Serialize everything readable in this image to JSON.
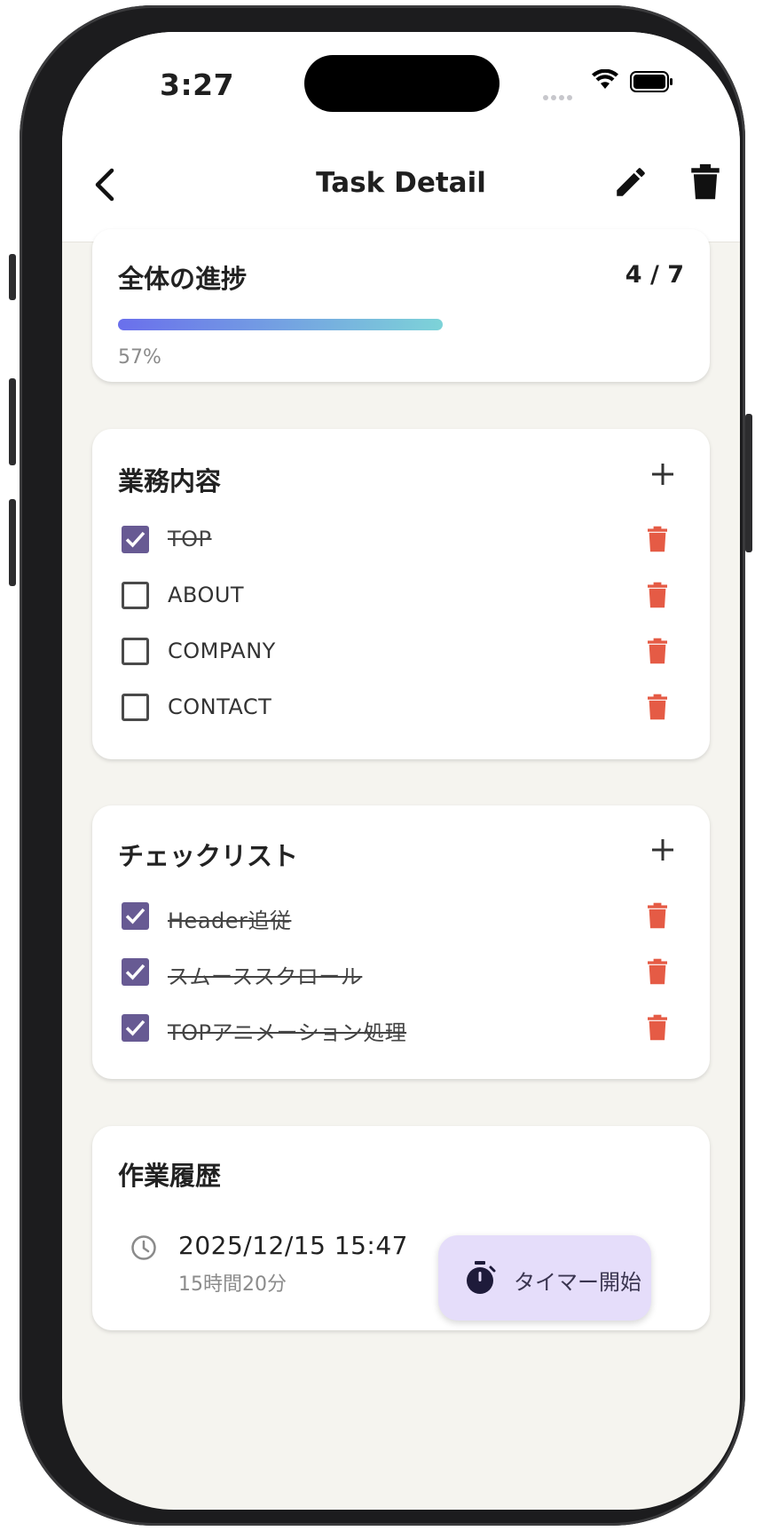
{
  "status_bar": {
    "time": "3:27"
  },
  "app_bar": {
    "title": "Task Detail"
  },
  "progress": {
    "title": "全体の進捗",
    "count": "4 / 7",
    "percent_label": "57%",
    "value": 0.57
  },
  "tasks": {
    "title": "業務内容",
    "items": [
      {
        "label": "TOP",
        "checked": true
      },
      {
        "label": "ABOUT",
        "checked": false
      },
      {
        "label": "COMPANY",
        "checked": false
      },
      {
        "label": "CONTACT",
        "checked": false
      }
    ]
  },
  "checklist": {
    "title": "チェックリスト",
    "items": [
      {
        "label": "Header追従",
        "checked": true
      },
      {
        "label": "スムーススクロール",
        "checked": true
      },
      {
        "label": "TOPアニメーション処理",
        "checked": true
      }
    ]
  },
  "history": {
    "title": "作業履歴",
    "entries": [
      {
        "date": "2025/12/15 15:47",
        "duration": "15時間20分"
      }
    ]
  },
  "timer_button": {
    "label": "タイマー開始"
  },
  "colors": {
    "checkbox": "#675a93",
    "delete": "#e55b45",
    "fab_bg": "#e5ddfa",
    "progress_start": "#6a6fec",
    "progress_end": "#7dd3d8"
  },
  "icons": [
    "back-icon",
    "edit-icon",
    "trash-icon",
    "plus-icon",
    "check-icon",
    "delete-icon",
    "clock-icon",
    "stopwatch-icon"
  ]
}
